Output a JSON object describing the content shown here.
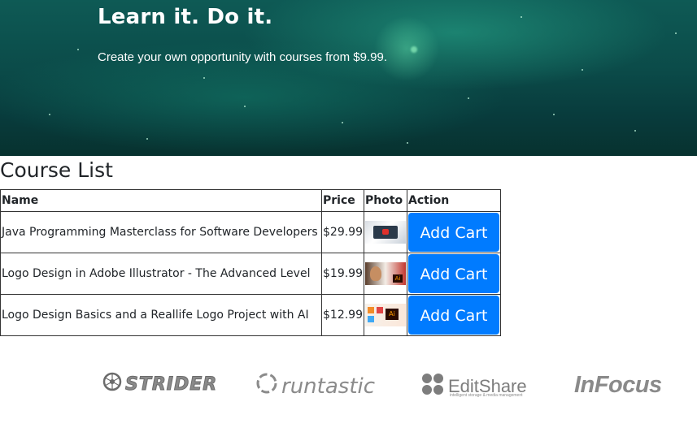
{
  "hero": {
    "title": "Learn it. Do it.",
    "subtitle": "Create your own opportunity with courses from $9.99."
  },
  "course_list": {
    "title": "Course List",
    "columns": [
      "Name",
      "Price",
      "Photo",
      "Action"
    ],
    "rows": [
      {
        "name": "Java Programming Masterclass for Software Developers",
        "price": "$29.99",
        "photo_icon": "laptop-thumbnail",
        "action": "Add Cart"
      },
      {
        "name": "Logo Design in Adobe Illustrator - The Advanced Level",
        "price": "$19.99",
        "photo_icon": "illustrator-thumbnail",
        "action": "Add Cart"
      },
      {
        "name": "Logo Design Basics and a Reallife Logo Project with AI",
        "price": "$12.99",
        "photo_icon": "logo-design-thumbnail",
        "action": "Add Cart"
      }
    ]
  },
  "partners": [
    {
      "name": "STRIDER"
    },
    {
      "name": "runtastic"
    },
    {
      "name": "EditShare",
      "tagline": "intelligent storage & media management"
    },
    {
      "name": "InFocus"
    }
  ],
  "colors": {
    "accent": "#007bff",
    "hero_bg": "#0b4b49",
    "logo_gray": "#8a8a8a"
  }
}
